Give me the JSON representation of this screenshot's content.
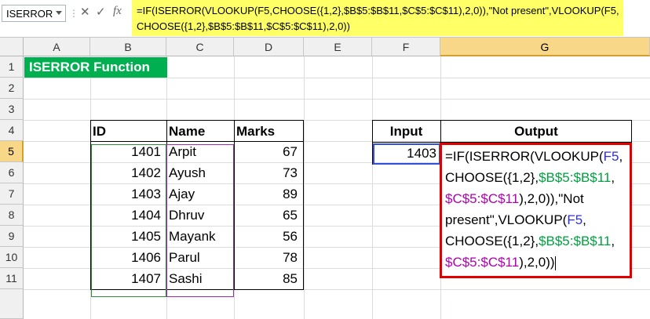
{
  "namebox": {
    "value": "ISERROR"
  },
  "formula_bar": {
    "line1": "=IF(ISERROR(VLOOKUP(F5,CHOOSE({1,2},$B$5:$B$11,$C$5:$C$11),2,0)),\"Not present\",VLOOKUP(F5,",
    "line2": "CHOOSE({1,2},$B$5:$B$11,$C$5:$C$11),2,0))",
    "cancel": "✕",
    "enter": "✓",
    "fx": "fx"
  },
  "columns": [
    "A",
    "B",
    "C",
    "D",
    "E",
    "F",
    "G"
  ],
  "rows": [
    "1",
    "2",
    "3",
    "4",
    "5",
    "6",
    "7",
    "8",
    "9",
    "10",
    "11"
  ],
  "title_cell": "ISERROR Function",
  "table": {
    "headers": [
      "ID",
      "Name",
      "Marks"
    ],
    "rows": [
      [
        "1401",
        "Arpit",
        "67"
      ],
      [
        "1402",
        "Ayush",
        "73"
      ],
      [
        "1403",
        "Ajay",
        "89"
      ],
      [
        "1404",
        "Dhruv",
        "65"
      ],
      [
        "1405",
        "Mayank",
        "56"
      ],
      [
        "1406",
        "Parul",
        "78"
      ],
      [
        "1407",
        "Sashi",
        "85"
      ]
    ]
  },
  "lookup": {
    "input_header": "Input",
    "output_header": "Output",
    "input_value": "1403"
  },
  "output_formula": [
    {
      "t": "=IF(ISERROR(",
      "c": "k"
    },
    {
      "t": "VLOOKUP(",
      "c": "k"
    },
    {
      "t": "F5",
      "c": "b"
    },
    {
      "t": ",\n",
      "c": "k"
    },
    {
      "t": "CHOOSE({1,2},",
      "c": "k"
    },
    {
      "t": "$B$5:$B$11",
      "c": "g"
    },
    {
      "t": ",\n",
      "c": "k"
    },
    {
      "t": "$C$5:$C$11",
      "c": "p"
    },
    {
      "t": "),2,0)),\"Not\npresent\",VLOOKUP(",
      "c": "k"
    },
    {
      "t": "F5",
      "c": "b"
    },
    {
      "t": ",\n",
      "c": "k"
    },
    {
      "t": "CHOOSE({1,2},",
      "c": "k"
    },
    {
      "t": "$B$5:$B$11",
      "c": "g"
    },
    {
      "t": ",\n",
      "c": "k"
    },
    {
      "t": "$C$5:$C$11",
      "c": "p"
    },
    {
      "t": "),2,0))",
      "c": "k"
    }
  ],
  "colors": {
    "title_bg": "#00b050",
    "formula_bg": "#ffff66",
    "output_border": "#e00000"
  }
}
